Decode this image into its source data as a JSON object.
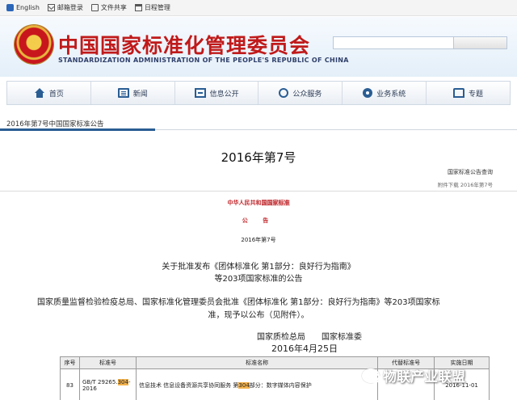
{
  "topbar": {
    "items": [
      {
        "label": "English",
        "icon": "globe-icon"
      },
      {
        "label": "邮箱登录",
        "icon": "mail-icon"
      },
      {
        "label": "文件共享",
        "icon": "document-icon"
      },
      {
        "label": "日程管理",
        "icon": "calendar-icon"
      }
    ]
  },
  "header": {
    "title_cn": "中国国家标准化管理委员会",
    "title_en": "STANDARDIZATION ADMINISTRATION OF THE PEOPLE'S REPUBLIC OF CHINA",
    "emblem_icon": "national-emblem-icon"
  },
  "nav": {
    "items": [
      {
        "label": "首页",
        "icon": "home-icon"
      },
      {
        "label": "新闻",
        "icon": "news-icon"
      },
      {
        "label": "信息公开",
        "icon": "info-icon"
      },
      {
        "label": "公众服务",
        "icon": "public-service-icon"
      },
      {
        "label": "业务系统",
        "icon": "business-system-icon"
      },
      {
        "label": "专题",
        "icon": "topic-icon"
      }
    ]
  },
  "breadcrumb": "2016年第7号中国国家标准公告",
  "article": {
    "title": "2016年第7号",
    "meta_category": "国家标准公告查询",
    "meta_attachment": "附件下载 2016年第7号",
    "issuer_a": "中华人民共和",
    "issuer_b": "国国家标准",
    "gonggao": "公 告",
    "number": "2016年第7号",
    "announce_line1": "关于批准发布《团体标准化 第1部分：良好行为指南》",
    "announce_line2": "等203项国家标准的公告",
    "body_line1": "国家质量监督检验检疫总局、国家标准化管理委员会批准《团体标准化 第1部分：良好行为指南》等203项国家标",
    "body_line2": "准，现予以公布（见附件）。",
    "signature": "国家质检总局　　国家标准委",
    "date": "2016年4月25日"
  },
  "table": {
    "headers": [
      "序号",
      "标准号",
      "标准名称",
      "代替标准号",
      "实施日期"
    ],
    "row": {
      "index": "83",
      "code_a": "GB/T 29265.",
      "code_mark": "304",
      "code_b": "-2016",
      "name_a": "信息技术 信息设备资源共享协同服务 第",
      "name_mark": "304",
      "name_b": "部分：数字媒体内容保护",
      "replaces": "",
      "date": "2016-11-01"
    }
  },
  "watermark": {
    "text": "物联产业联盟",
    "icon": "wechat-icon"
  },
  "colors": {
    "title_red": "#c01a1a",
    "nav_blue": "#2a5d93",
    "highlight": "#f3b24c"
  }
}
